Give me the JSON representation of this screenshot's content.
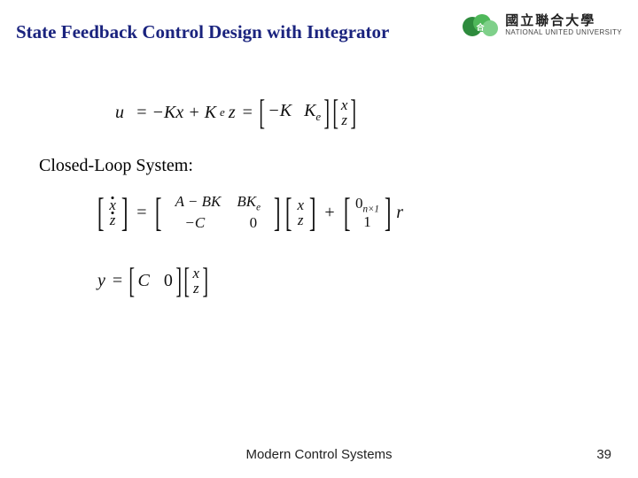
{
  "title": "State Feedback Control Design with Integrator",
  "university": {
    "name_cn": "國立聯合大學",
    "name_en": "NATIONAL UNITED UNIVERSITY"
  },
  "subhead": "Closed-Loop System:",
  "eq1": {
    "lhs": "u",
    "rhs_text1": "= −Kx + K",
    "rhs_sub1": "e",
    "rhs_text2": "z",
    "row_a": "−K",
    "row_b": "K",
    "row_b_sub": "e",
    "vec_top": "x",
    "vec_bot": "z"
  },
  "eq2": {
    "lvec_top": "x",
    "lvec_bot": "z",
    "m11": "A − BK",
    "m12_a": "BK",
    "m12_sub": "e",
    "m21": "−C",
    "m22": "0",
    "rvec_top": "x",
    "rvec_bot": "z",
    "plus": "+",
    "bvec_top": "0",
    "bvec_top_sub": "n×1",
    "bvec_bot": "1",
    "tail": "r"
  },
  "eq3": {
    "lhs": "y",
    "row_a": "C",
    "row_b": "0",
    "vec_top": "x",
    "vec_bot": "z"
  },
  "footer": {
    "center": "Modern Control Systems",
    "page": "39"
  }
}
